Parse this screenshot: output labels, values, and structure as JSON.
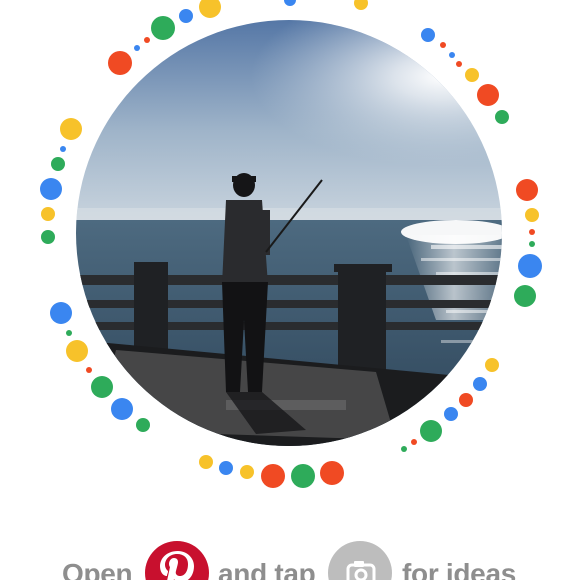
{
  "photo": {
    "subject": "fisherman silhouette on pier at sunset"
  },
  "instruction": {
    "open_text": "Open",
    "and_tap_text": "and tap",
    "for_ideas_text": "for ideas",
    "pinterest_icon": "pinterest-logo-icon",
    "camera_icon": "camera-lens-icon"
  },
  "colors": {
    "pinterest_red": "#c8102e",
    "camera_gray": "#bdbdbd",
    "text_gray": "#8e8e8e",
    "dot_red": "#f04a23",
    "dot_blue": "#3a86f0",
    "dot_yellow": "#f7c22a",
    "dot_green": "#2eab5a"
  }
}
